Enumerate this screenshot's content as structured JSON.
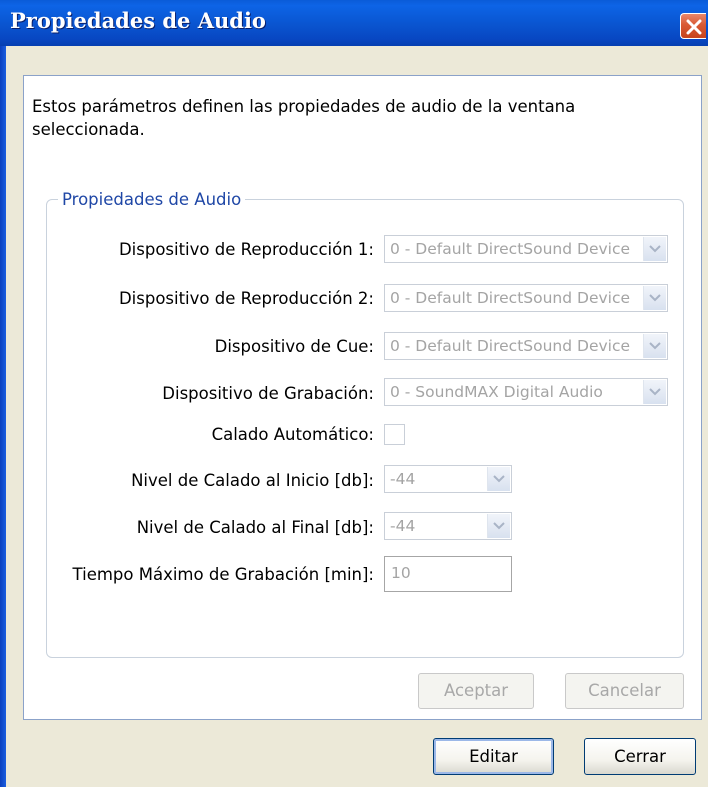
{
  "window": {
    "title": "Propiedades de Audio"
  },
  "description": "Estos parámetros definen las propiedades de audio de la ventana seleccionada.",
  "group": {
    "title": "Propiedades de Audio",
    "playback1": {
      "label": "Dispositivo de Reproducción 1:",
      "value": "0 - Default DirectSound Device"
    },
    "playback2": {
      "label": "Dispositivo de Reproducción 2:",
      "value": "0 - Default DirectSound Device"
    },
    "cue": {
      "label": "Dispositivo de Cue:",
      "value": "0 - Default DirectSound Device"
    },
    "recording": {
      "label": "Dispositivo de Grabación:",
      "value": "0 - SoundMAX Digital Audio"
    },
    "auto_trim": {
      "label": "Calado Automático:",
      "checked": false
    },
    "trim_start": {
      "label": "Nivel de Calado al Inicio [db]:",
      "value": "-44"
    },
    "trim_end": {
      "label": "Nivel de Calado al Final [db]:",
      "value": "-44"
    },
    "max_rec_time": {
      "label": "Tiempo Máximo de Grabación [min]:",
      "value": "10"
    }
  },
  "buttons": {
    "accept": "Aceptar",
    "cancel": "Cancelar",
    "edit": "Editar",
    "close": "Cerrar"
  },
  "icons": {
    "close": "close-icon",
    "dropdown": "chevron-down-icon"
  },
  "colors": {
    "titlebar": "#0a56d2",
    "close": "#d95a34",
    "group_title": "#1f47a6",
    "disabled_text": "#a4a4a4"
  }
}
